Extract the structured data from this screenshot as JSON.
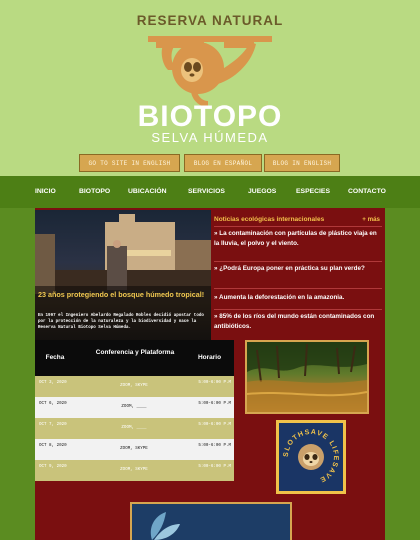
{
  "header": {
    "top_text": "RESERVA NATURAL",
    "brand": "BIOTOPO",
    "subtitle": "SELVA HÚMEDA",
    "buttons": [
      "GO TO SITE IN ENGLISH",
      "BLOG EN ESPAÑOL",
      "BLOG IN ENGLISH"
    ]
  },
  "nav": [
    "INICIO",
    "BIOTOPO",
    "UBICACIÓN",
    "SERVICIOS",
    "JUEGOS",
    "ESPECIES",
    "CONTACTO"
  ],
  "hero": {
    "title": "23 años protegiendo el bosque húmedo tropical!",
    "text": "En 1997 el Ingeniero Abelardo Regalado Robles decidió apostar todo por la protección de la naturaleza y la biodiversidad y nace la Reserva Natural Biotopo Selva Húmeda."
  },
  "news": {
    "title": "Noticias ecológicas internacionales",
    "more": "+ más",
    "items": [
      "» La contaminación con partículas de plástico viaja en la lluvia, el polvo y el viento.",
      "» ¿Podrá Europa poner en práctica su plan verde?",
      "» Aumenta la deforestación en la amazonia.",
      "» 85% de los ríos del mundo están contaminados con antibióticos."
    ]
  },
  "schedule": {
    "headers": [
      "Fecha",
      "Conferencia y Plataforma",
      "Horario"
    ],
    "rows": [
      [
        "OCT 3, 2020",
        "ZOOM, SKYPE",
        "5:00-6:00 P.M"
      ],
      [
        "OCT 6, 2020",
        "ZOOM, ____",
        "5:00-6:00 P.M"
      ],
      [
        "OCT 7, 2020",
        "ZOOM, ____",
        "5:00-6:00 P.M"
      ],
      [
        "OCT 8, 2020",
        "ZOOM, SKYPE",
        "5:00-6:00 P.M"
      ],
      [
        "OCT 9, 2020",
        "ZOOM, SKYPE",
        "5:00-6:00 P.M"
      ]
    ]
  },
  "badge": {
    "text": "SLOTHSAVE LIFESAVE"
  },
  "colors": {
    "header_bg": "#b9da82",
    "nav_bg": "#4d7f15",
    "panel_bg": "#7a0f10",
    "accent_gold": "#f3c24b",
    "button_bg": "#d6a650"
  }
}
